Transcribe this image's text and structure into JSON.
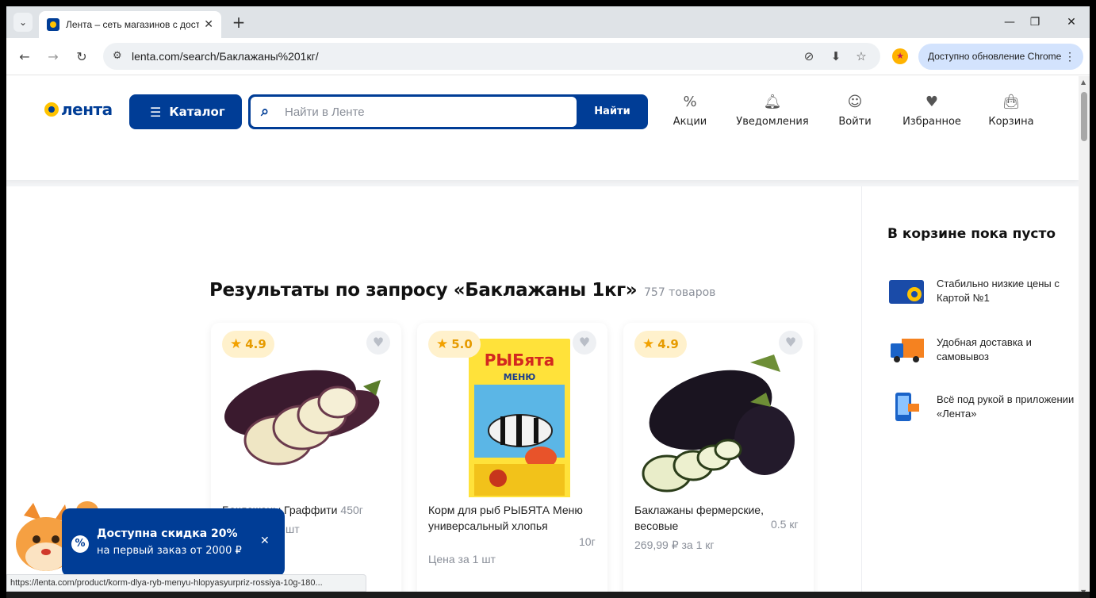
{
  "browser": {
    "tab_title": "Лента – сеть магазинов с доставкой",
    "url": "lenta.com/search/Баклажаны%201кг/",
    "update_label": "Доступно обновление Chrome",
    "status_url": "https://lenta.com/product/korm-dlya-ryb-menyu-hlopyasyurpriz-rossiya-10g-180..."
  },
  "header": {
    "logo_text": "лента",
    "catalog_label": "Каталог",
    "search_placeholder": "Найти в Ленте",
    "search_button": "Найти",
    "nav": [
      {
        "label": "Акции",
        "icon": "percent-icon"
      },
      {
        "label": "Уведомления",
        "icon": "bell-icon"
      },
      {
        "label": "Войти",
        "icon": "user-icon"
      },
      {
        "label": "Избранное",
        "icon": "heart-icon"
      },
      {
        "label": "Корзина",
        "icon": "cart-icon"
      }
    ]
  },
  "results": {
    "title": "Результаты по запросу «Баклажаны 1кг»",
    "count": "757 товаров"
  },
  "products": [
    {
      "rating": "4.9",
      "name": "Баклажаны Граффити",
      "weight": "450г",
      "price": "шт"
    },
    {
      "rating": "5.0",
      "name": "Корм для рыб РЫБЯТА Меню универсальный хлопья",
      "weight": "10г",
      "price": "Цена за 1 шт",
      "package_brand": "РЫБята",
      "package_subtitle": "МЕНЮ"
    },
    {
      "rating": "4.9",
      "name": "Баклажаны фермерские, весовые",
      "weight": "0.5 кг",
      "price": "269,99 ₽ за 1 кг"
    }
  ],
  "sidebar": {
    "cart_empty": "В корзине пока пусто",
    "perks": [
      {
        "text": "Стабильно низкие цены с Картой №1",
        "icon": "card-icon"
      },
      {
        "text": "Удобная доставка и самовывоз",
        "icon": "truck-icon"
      },
      {
        "text": "Всё под рукой в приложении «Лента»",
        "icon": "phone-icon"
      }
    ]
  },
  "promo": {
    "heading": "Доступна скидка 20%",
    "sub": "на первый заказ от 2000 ₽"
  },
  "colors": {
    "brand": "#003d96",
    "accent": "#ffc300"
  }
}
